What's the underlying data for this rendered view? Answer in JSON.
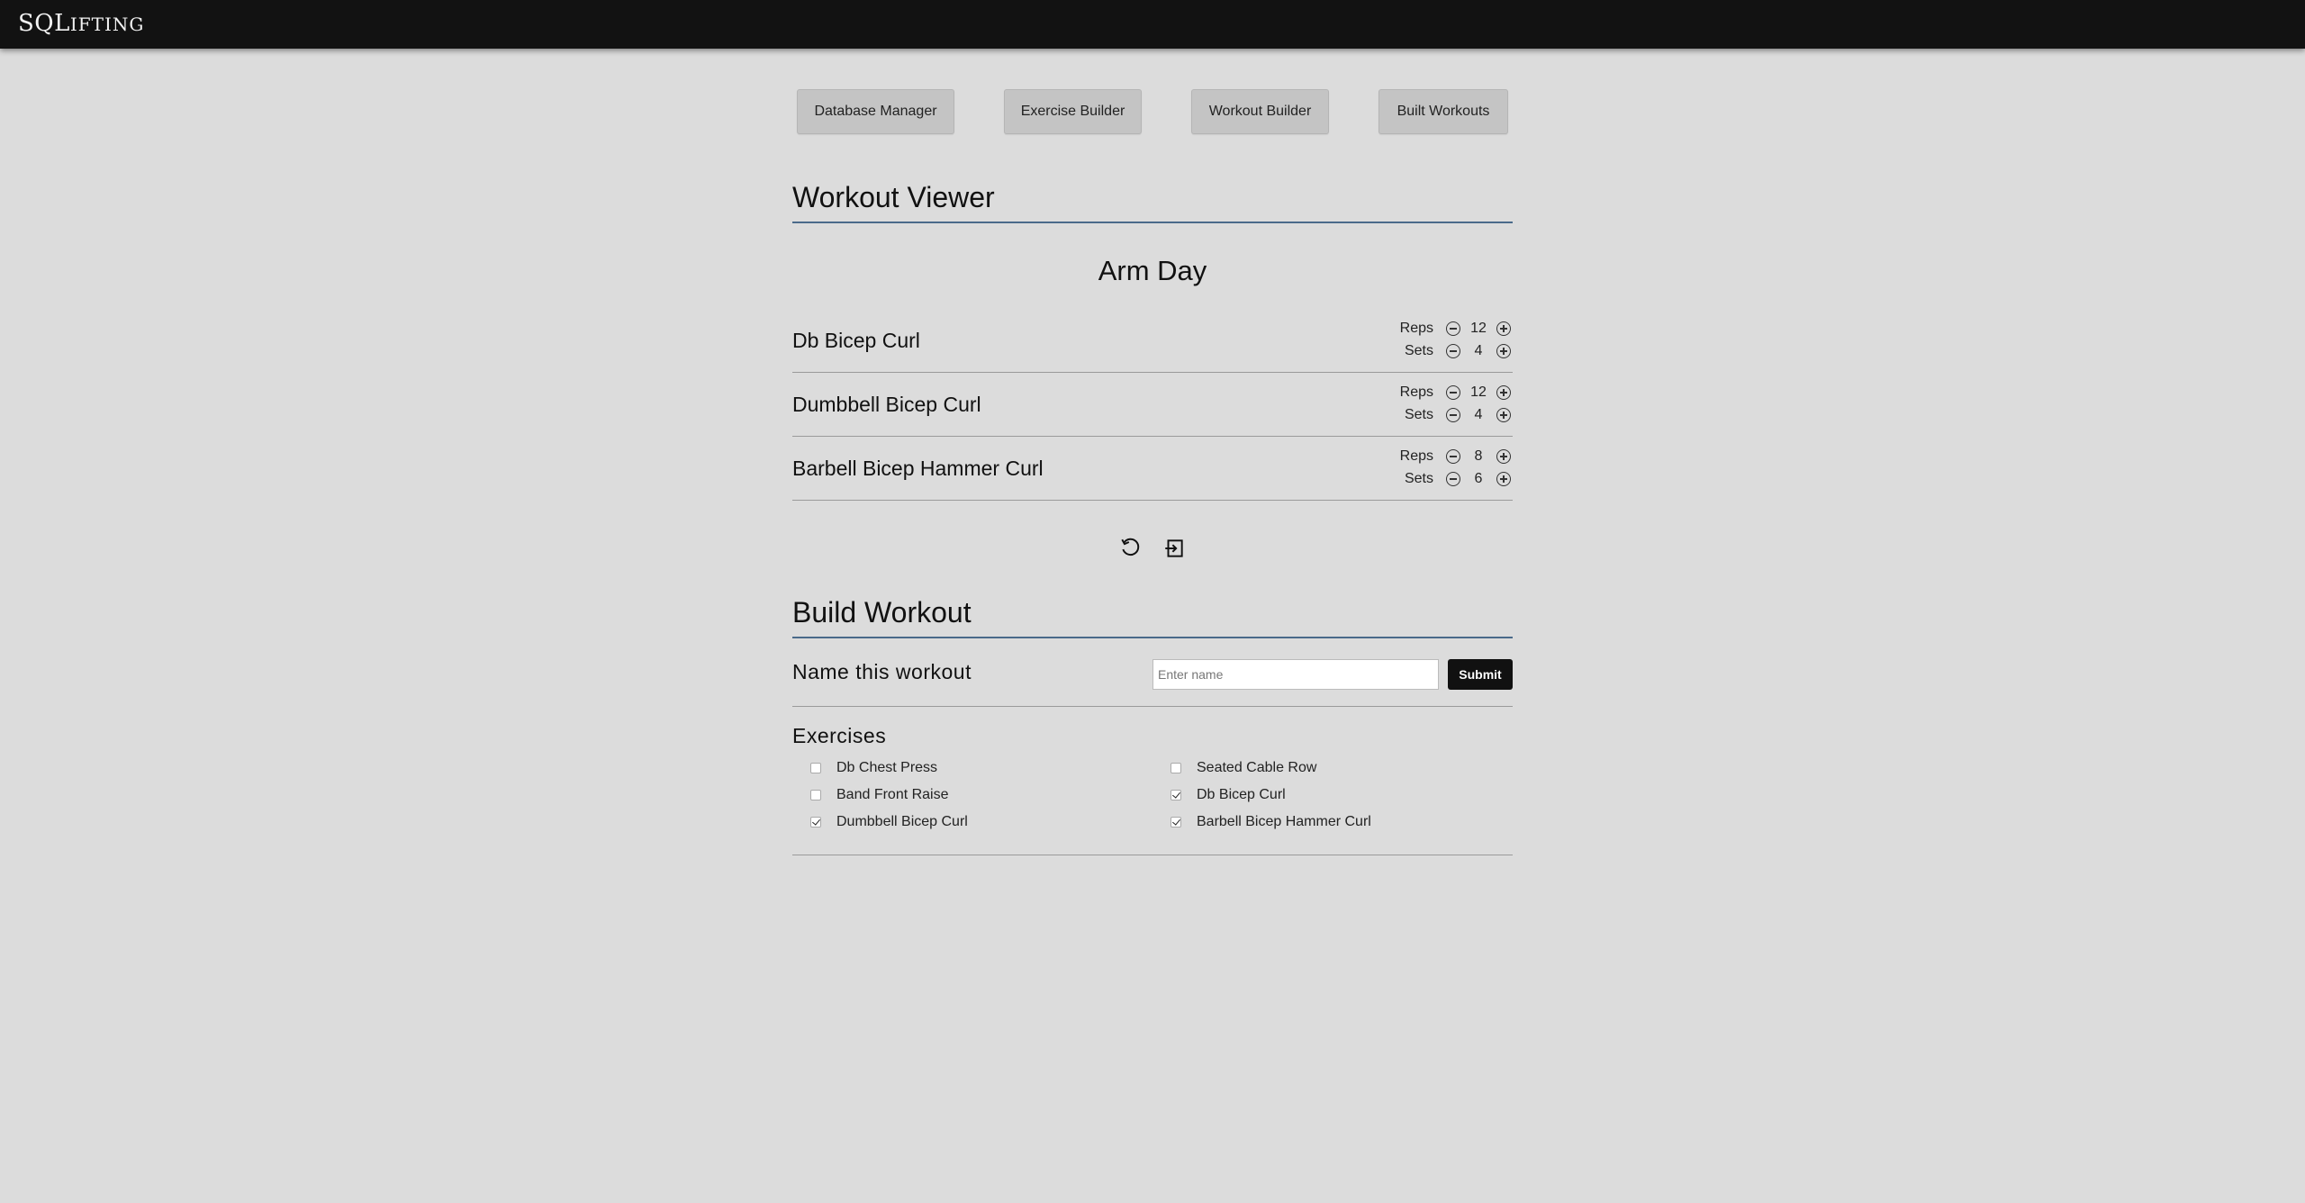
{
  "app": {
    "brand_big": "SQL",
    "brand_small": "IFTING"
  },
  "nav": [
    {
      "label": "Database Manager"
    },
    {
      "label": "Exercise Builder"
    },
    {
      "label": "Workout Builder"
    },
    {
      "label": "Built Workouts"
    }
  ],
  "viewer": {
    "title": "Workout Viewer",
    "workout_name": "Arm Day",
    "reps_label": "Reps",
    "sets_label": "Sets",
    "exercises": [
      {
        "name": "Db Bicep Curl",
        "reps": "12",
        "sets": "4"
      },
      {
        "name": "Dumbbell Bicep Curl",
        "reps": "12",
        "sets": "4"
      },
      {
        "name": "Barbell Bicep Hammer Curl",
        "reps": "8",
        "sets": "6"
      }
    ],
    "icons": {
      "reset": "reset-icon",
      "export": "export-icon"
    }
  },
  "builder": {
    "title": "Build Workout",
    "name_label": "Name this workout",
    "name_placeholder": "Enter name",
    "name_value": "",
    "submit_label": "Submit",
    "exercises_title": "Exercises",
    "options": [
      {
        "label": "Db Chest Press",
        "checked": false
      },
      {
        "label": "Seated Cable Row",
        "checked": false
      },
      {
        "label": "Band Front Raise",
        "checked": false
      },
      {
        "label": "Db Bicep Curl",
        "checked": true
      },
      {
        "label": "Dumbbell Bicep Curl",
        "checked": true
      },
      {
        "label": "Barbell Bicep Hammer Curl",
        "checked": true
      }
    ]
  },
  "colors": {
    "topbar": "#121212",
    "background": "#dcdcdc",
    "accent_rule": "#4a6a8a",
    "submit": "#111111"
  }
}
